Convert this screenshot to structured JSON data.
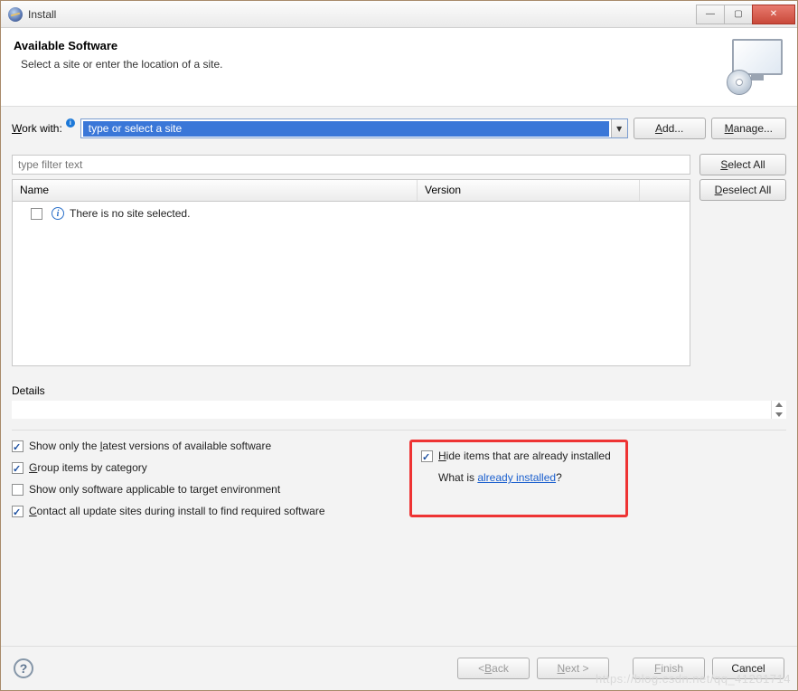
{
  "window": {
    "title": "Install"
  },
  "header": {
    "title": "Available Software",
    "subtitle": "Select a site or enter the location of a site."
  },
  "workwith": {
    "label_pre": "",
    "label_u": "W",
    "label_post": "ork with:",
    "placeholder": "type or select a site"
  },
  "buttons": {
    "add_u": "A",
    "add_post": "dd...",
    "manage_u": "M",
    "manage_post": "anage...",
    "selectall_u": "S",
    "selectall_post": "elect All",
    "deselectall_u": "D",
    "deselectall_post": "eselect All",
    "back_pre": "< ",
    "back_u": "B",
    "back_post": "ack",
    "next_u": "N",
    "next_post": "ext >",
    "finish_u": "F",
    "finish_post": "inish",
    "cancel": "Cancel"
  },
  "filter": {
    "placeholder": "type filter text"
  },
  "table": {
    "col_name": "Name",
    "col_version": "Version",
    "empty_row": "There is no site selected."
  },
  "details": {
    "label": "Details"
  },
  "options": {
    "show_latest_pre": "Show only the ",
    "show_latest_u": "l",
    "show_latest_post": "atest versions of available software",
    "group_u": "G",
    "group_post": "roup items by category",
    "applicable": "Show only software applicable to target environment",
    "contact_u": "C",
    "contact_post": "ontact all update sites during install to find required software",
    "hide_u": "H",
    "hide_post": "ide items that are already installed",
    "whatis_pre": "What is ",
    "whatis_link": "already installed",
    "whatis_post": "?"
  },
  "watermark": "https://blog.csdn.net/qq_41281714"
}
